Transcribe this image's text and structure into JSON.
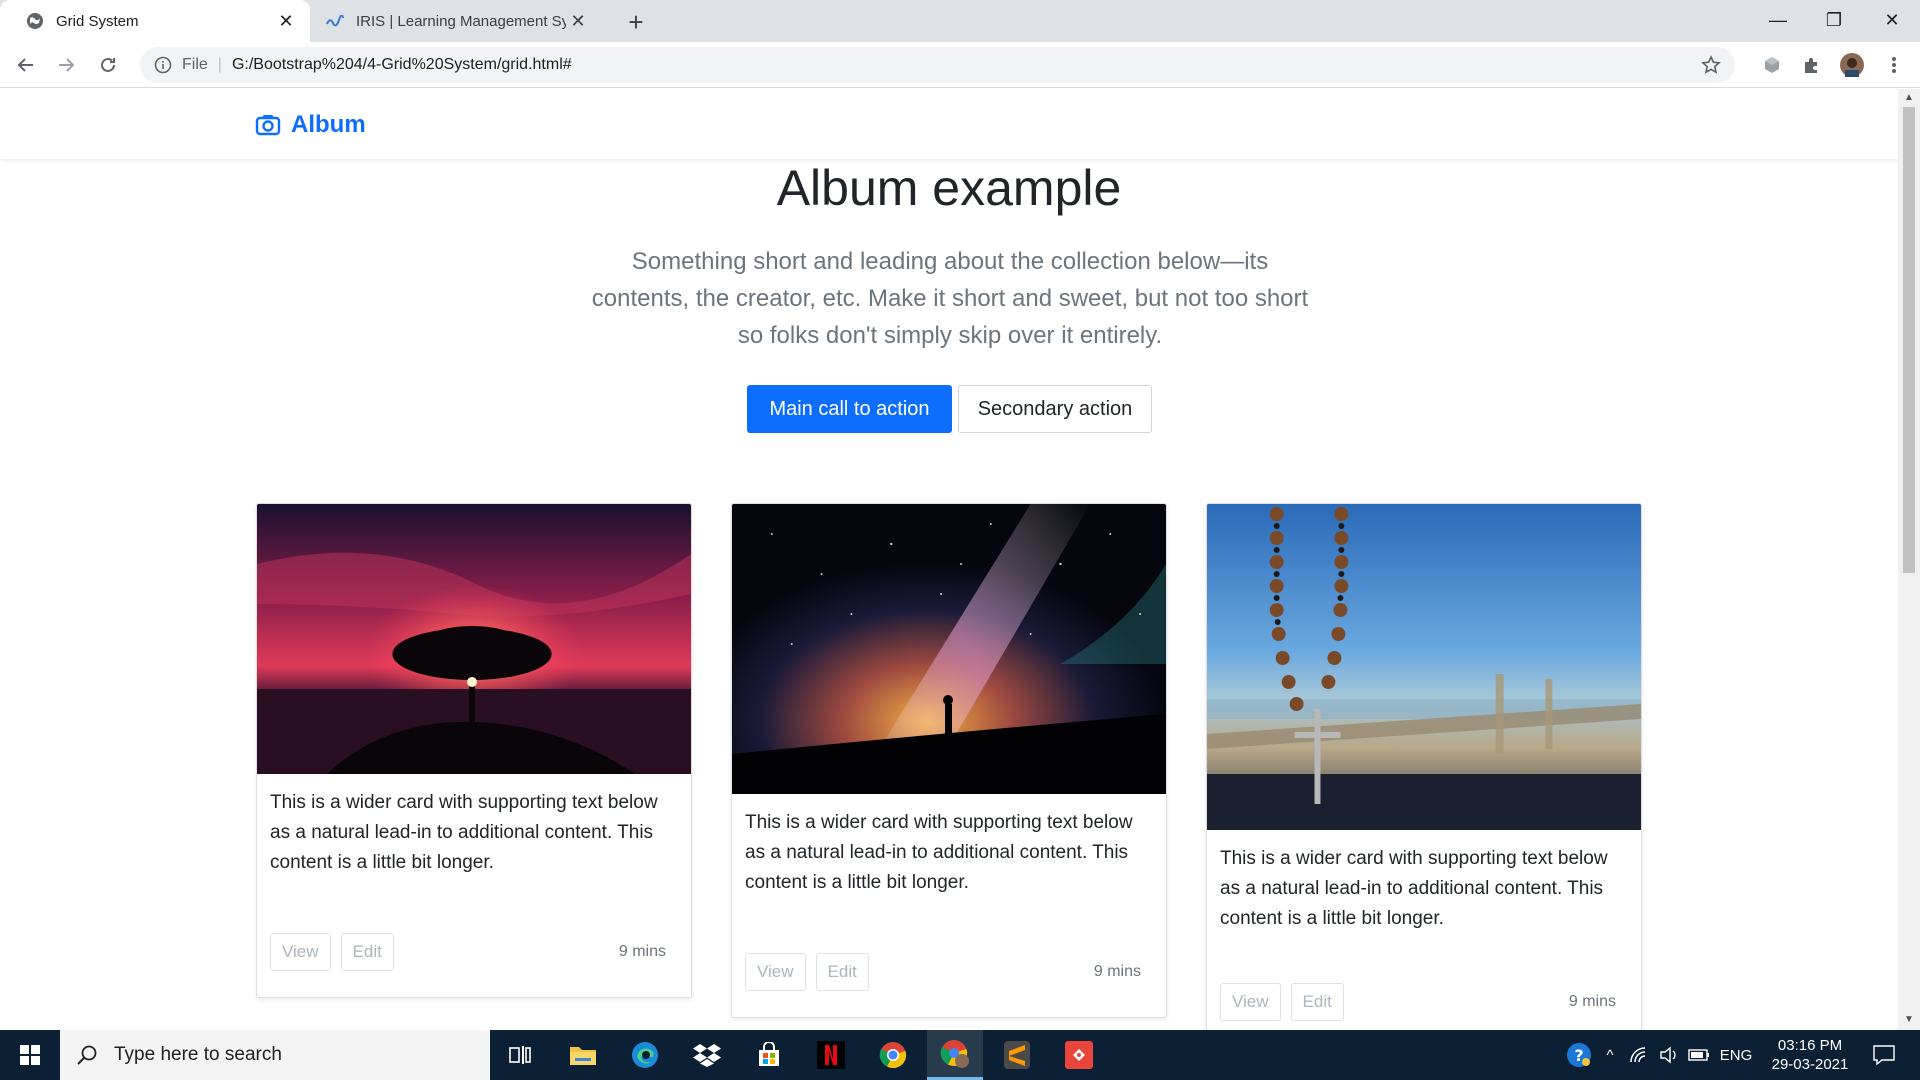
{
  "browser": {
    "tabs": [
      {
        "title": "Grid System",
        "active": true
      },
      {
        "title": "IRIS | Learning Management Syst",
        "active": false
      }
    ],
    "address": {
      "scheme": "File",
      "url": "G:/Bootstrap%204/4-Grid%20System/grid.html#"
    }
  },
  "page": {
    "brand": "Album",
    "hero": {
      "title": "Album example",
      "lead": "Something short and leading about the collection below—its contents, the creator, etc. Make it short and sweet, but not too short so folks don't simply skip over it entirely.",
      "primary_label": "Main call to action",
      "secondary_label": "Secondary action"
    },
    "cards": [
      {
        "image": "red-sunset-tree",
        "text": "This is a wider card with supporting text below as a natural lead-in to additional content. This content is a little bit longer.",
        "view_label": "View",
        "edit_label": "Edit",
        "time": "9 mins"
      },
      {
        "image": "milky-way-silhouette",
        "text": "This is a wider card with supporting text below as a natural lead-in to additional content. This content is a little bit longer.",
        "view_label": "View",
        "edit_label": "Edit",
        "time": "9 mins"
      },
      {
        "image": "rosary-seaside",
        "text": "This is a wider card with supporting text below as a natural lead-in to additional content. This content is a little bit longer.",
        "view_label": "View",
        "edit_label": "Edit",
        "time": "9 mins"
      }
    ],
    "accent_color": "#0d6efd"
  },
  "taskbar": {
    "search_placeholder": "Type here to search",
    "apps": [
      "task-view",
      "file-explorer",
      "edge",
      "dropbox",
      "store",
      "netflix",
      "chrome",
      "chrome-profile",
      "sublime-text",
      "git-app"
    ],
    "tray": {
      "language": "ENG",
      "time": "03:16 PM",
      "date": "29-03-2021"
    }
  }
}
